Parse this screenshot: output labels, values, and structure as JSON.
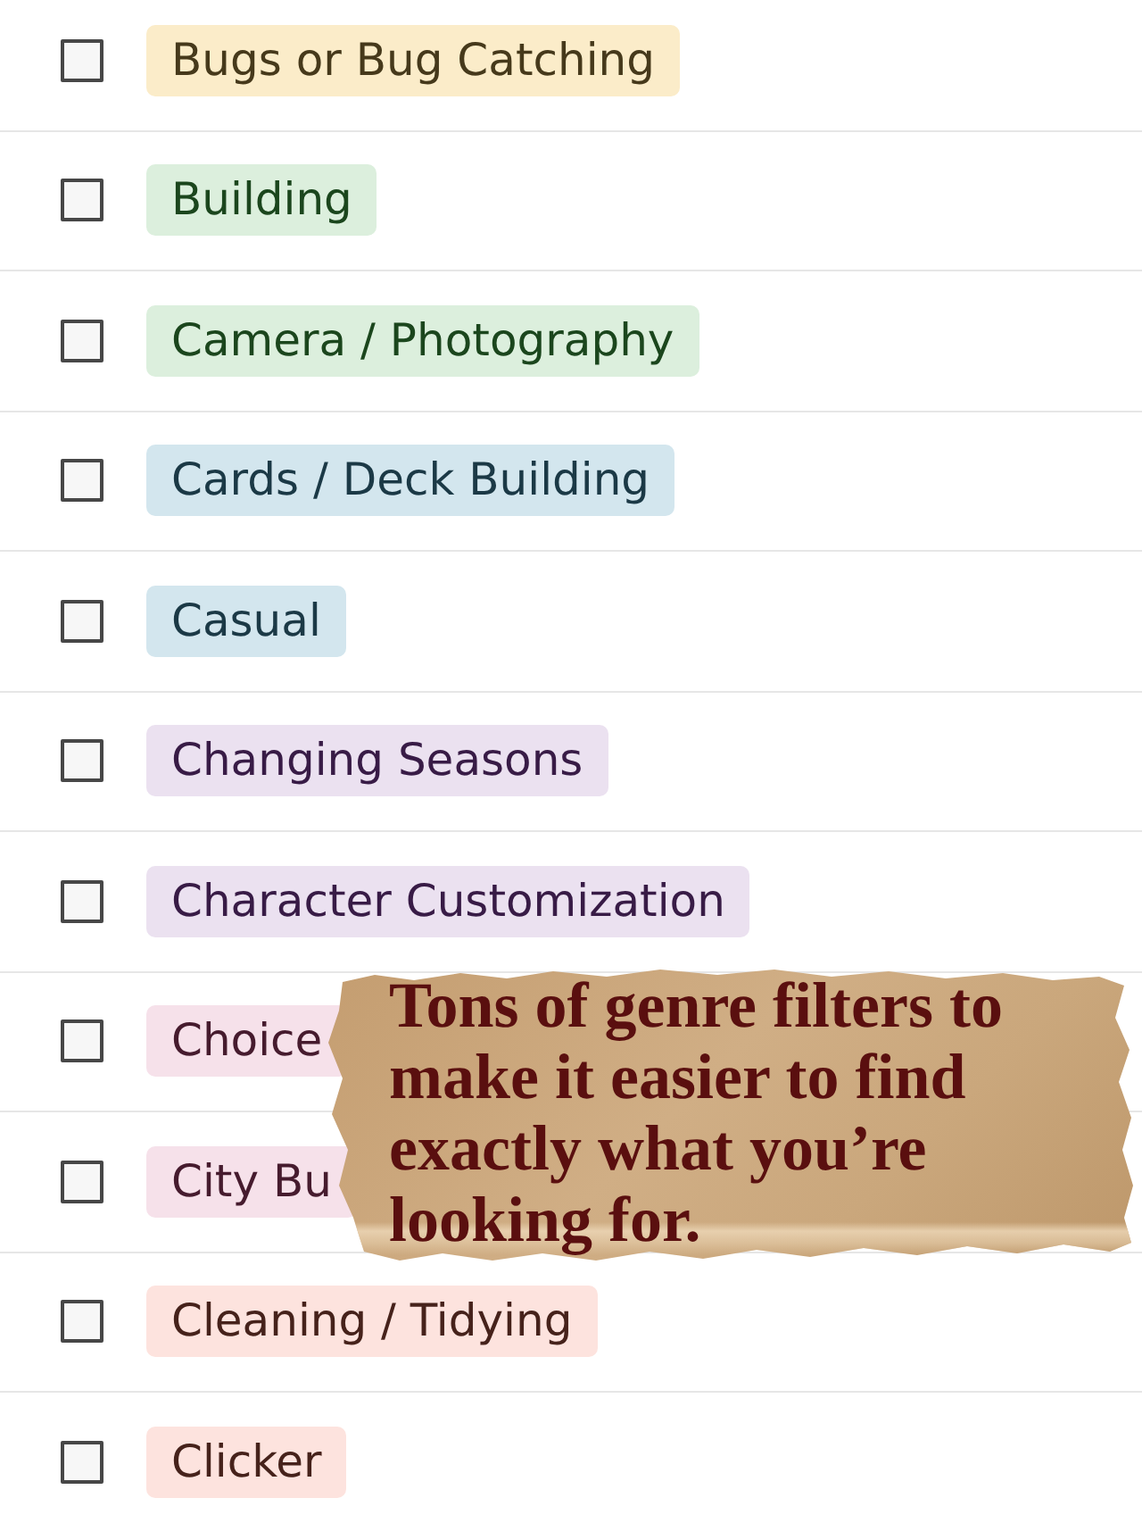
{
  "items": [
    {
      "label": "Bugs or Bug Catching",
      "checked": false,
      "color": "#fbecc9"
    },
    {
      "label": "Building",
      "checked": false,
      "color": "#dcefdd"
    },
    {
      "label": "Camera / Photography",
      "checked": false,
      "color": "#dcefdd"
    },
    {
      "label": "Cards / Deck Building",
      "checked": false,
      "color": "#d3e6ee"
    },
    {
      "label": "Casual",
      "checked": false,
      "color": "#d3e6ee"
    },
    {
      "label": "Changing Seasons",
      "checked": false,
      "color": "#ebe1f0"
    },
    {
      "label": "Character Customization",
      "checked": false,
      "color": "#ebe1f0"
    },
    {
      "label": "Choice",
      "checked": false,
      "color": "#f6e1ea"
    },
    {
      "label": "City Bu",
      "checked": false,
      "color": "#f6e1ea"
    },
    {
      "label": "Cleaning / Tidying",
      "checked": false,
      "color": "#fde3de"
    },
    {
      "label": "Clicker",
      "checked": false,
      "color": "#fde3de"
    }
  ],
  "note": {
    "text": "Tons of genre filters to make it easier to find exactly what you’re looking for."
  }
}
